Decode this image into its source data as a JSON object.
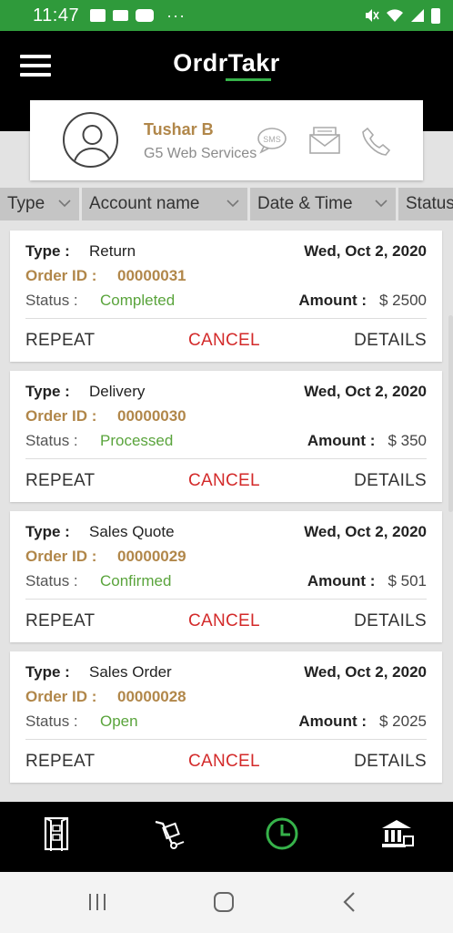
{
  "status_bar": {
    "time": "11:47",
    "left_icons": [
      "image-icon",
      "mail-icon",
      "youtube-icon"
    ],
    "overflow": "···",
    "right_icons": [
      "mute-icon",
      "wifi-icon",
      "signal-icon",
      "battery-icon"
    ]
  },
  "app_bar": {
    "logo": "OrdrTakr",
    "menu_icon": "hamburger-menu-icon"
  },
  "profile": {
    "name": "Tushar B",
    "company": "G5 Web Services",
    "sms_label": "SMS",
    "actions": [
      "sms-icon",
      "mail-icon",
      "phone-icon"
    ]
  },
  "columns": [
    {
      "label": "Type"
    },
    {
      "label": "Account name"
    },
    {
      "label": "Date & Time"
    },
    {
      "label": "Status"
    }
  ],
  "labels": {
    "type": "Type :",
    "order_id": "Order ID :",
    "status": "Status :",
    "amount": "Amount :",
    "repeat": "REPEAT",
    "cancel": "CANCEL",
    "details": "DETAILS"
  },
  "orders": [
    {
      "type": "Return",
      "date": "Wed, Oct 2, 2020",
      "order_id": "00000031",
      "status": "Completed",
      "amount": "$ 2500"
    },
    {
      "type": "Delivery",
      "date": "Wed, Oct 2, 2020",
      "order_id": "00000030",
      "status": "Processed",
      "amount": "$ 350"
    },
    {
      "type": "Sales Quote",
      "date": "Wed, Oct 2, 2020",
      "order_id": "00000029",
      "status": "Confirmed",
      "amount": "$ 501"
    },
    {
      "type": "Sales Order",
      "date": "Wed, Oct 2, 2020",
      "order_id": "00000028",
      "status": "Open",
      "amount": "$ 2025"
    }
  ],
  "bottom_nav": [
    "catalog-icon",
    "cart-icon",
    "history-icon",
    "bank-icon"
  ],
  "bottom_nav_active": "history-icon",
  "colors": {
    "status_bar": "#2f9a3b",
    "accent_gold": "#b1874a",
    "status_green": "#5aa43c",
    "cancel_red": "#d32a2a",
    "active_green": "#36b24a"
  }
}
